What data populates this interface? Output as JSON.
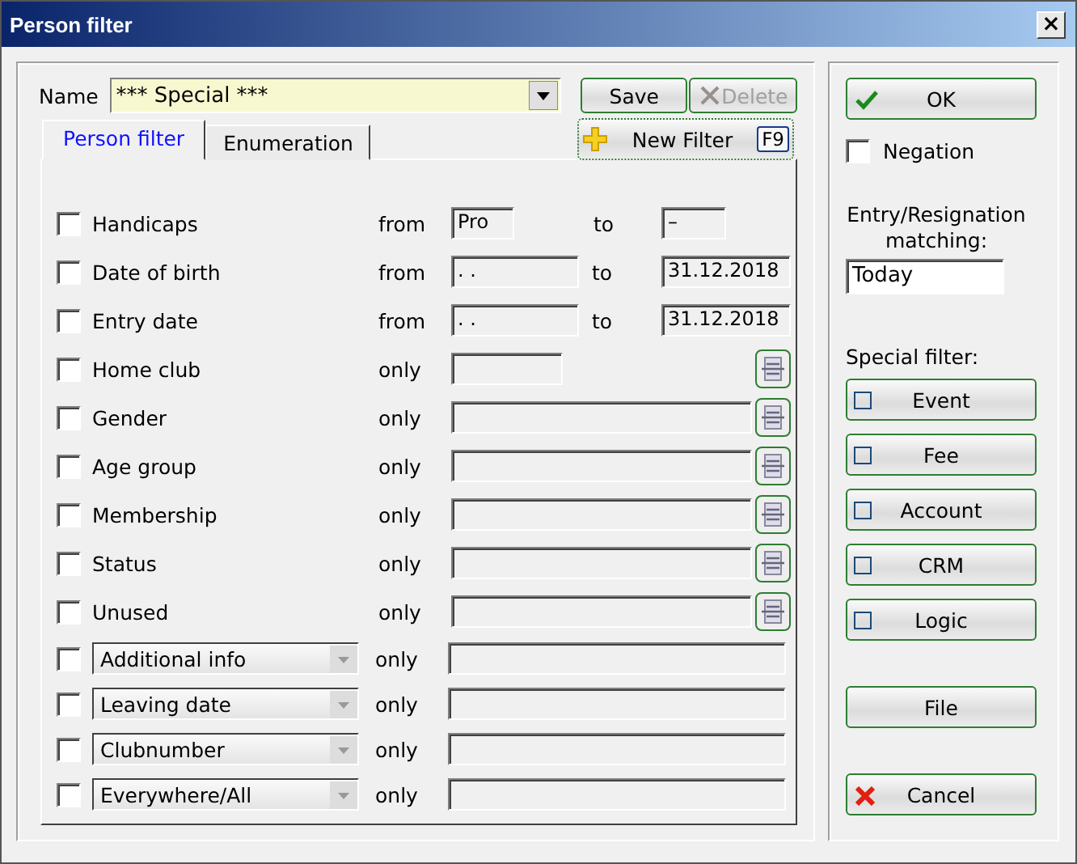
{
  "window": {
    "title": "Person filter",
    "close": "×"
  },
  "name_field": {
    "label": "Name",
    "value": "*** Special ***"
  },
  "buttons": {
    "save": {
      "label": "Save",
      "disabled": false
    },
    "delete": {
      "label": "Delete",
      "disabled": true
    },
    "new_filter": {
      "label": "New Filter",
      "shortcut": "F9"
    }
  },
  "tabs": [
    {
      "label": "Person filter",
      "selected": true
    },
    {
      "label": "Enumeration",
      "selected": false
    }
  ],
  "rows": [
    {
      "kind": "number-range",
      "checked": false,
      "label": "Handicaps",
      "keyword": "from",
      "from": "Pro",
      "to_label": "to",
      "to": "–"
    },
    {
      "kind": "date-range",
      "checked": false,
      "label": "Date of birth",
      "keyword": "from",
      "from": ". .",
      "to_label": "to",
      "to": "31.12.2018"
    },
    {
      "kind": "date-range",
      "checked": false,
      "label": "Entry date",
      "keyword": "from",
      "from": ". .",
      "to_label": "to",
      "to": "31.12.2018"
    },
    {
      "kind": "short-list",
      "checked": false,
      "label": "Home club",
      "keyword": "only"
    },
    {
      "kind": "list",
      "checked": false,
      "label": "Gender",
      "keyword": "only"
    },
    {
      "kind": "list",
      "checked": false,
      "label": "Age group",
      "keyword": "only"
    },
    {
      "kind": "list",
      "checked": false,
      "label": "Membership",
      "keyword": "only"
    },
    {
      "kind": "list",
      "checked": false,
      "label": "Status",
      "keyword": "only"
    },
    {
      "kind": "list",
      "checked": false,
      "label": "Unused",
      "keyword": "only"
    },
    {
      "kind": "select",
      "checked": false,
      "label": "Additional info",
      "keyword": "only"
    },
    {
      "kind": "select",
      "checked": false,
      "label": "Leaving date",
      "keyword": "only"
    },
    {
      "kind": "select",
      "checked": false,
      "label": "Clubnumber",
      "keyword": "only"
    },
    {
      "kind": "select",
      "checked": false,
      "label": "Everywhere/All",
      "keyword": "only"
    }
  ],
  "ok": {
    "label": "OK"
  },
  "negation": {
    "label": "Negation",
    "checked": false
  },
  "matching": {
    "label": "Entry/Resignation matching:",
    "value": "Today"
  },
  "special_filter": {
    "label": "Special filter:",
    "items": [
      {
        "label": "Event",
        "checked": false
      },
      {
        "label": "Fee",
        "checked": false
      },
      {
        "label": "Account",
        "checked": false
      },
      {
        "label": "CRM",
        "checked": false
      },
      {
        "label": "Logic",
        "checked": false
      }
    ]
  },
  "file": {
    "label": "File"
  },
  "cancel": {
    "label": "Cancel"
  }
}
